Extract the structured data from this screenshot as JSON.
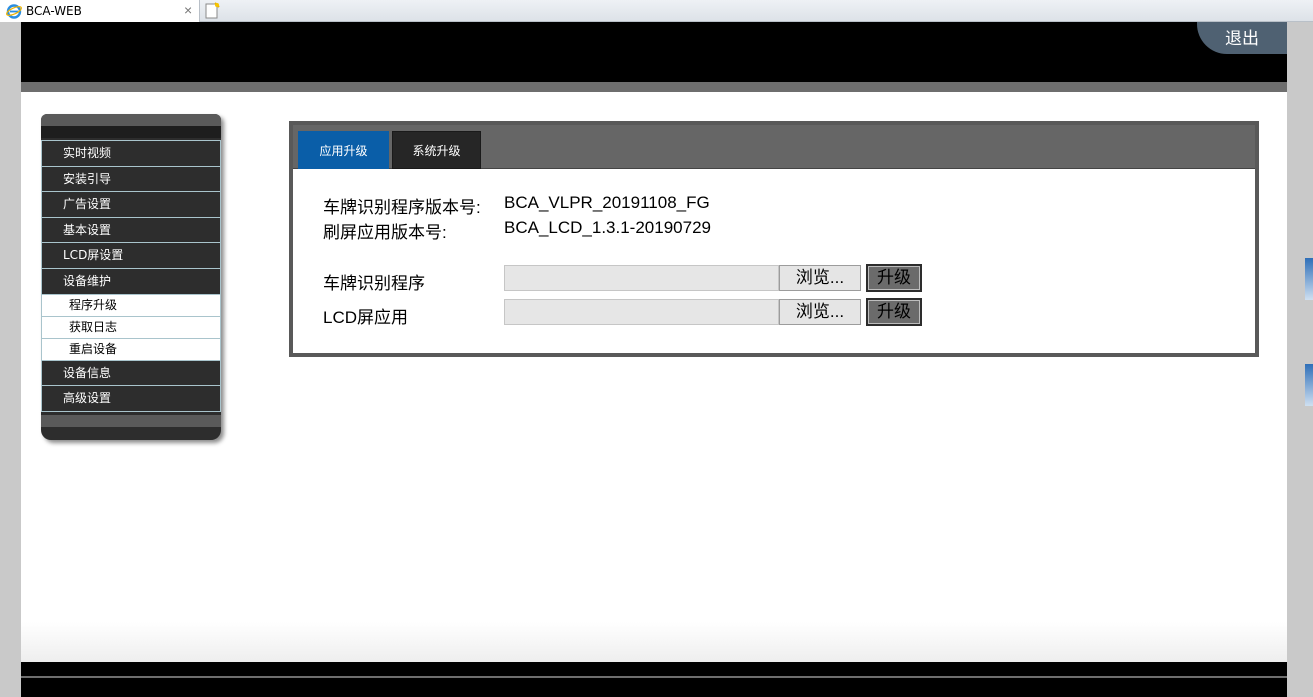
{
  "browser": {
    "tab_title": "BCA-WEB",
    "close_glyph": "×"
  },
  "header": {
    "logout_label": "退出"
  },
  "sidebar": {
    "items": [
      {
        "label": "实时视频"
      },
      {
        "label": "安装引导"
      },
      {
        "label": "广告设置"
      },
      {
        "label": "基本设置"
      },
      {
        "label": "LCD屏设置"
      },
      {
        "label": "设备维护",
        "expanded": true,
        "children": [
          {
            "label": "程序升级"
          },
          {
            "label": "获取日志"
          },
          {
            "label": "重启设备"
          }
        ]
      },
      {
        "label": "设备信息"
      },
      {
        "label": "高级设置"
      }
    ]
  },
  "panel": {
    "tabs": [
      {
        "label": "应用升级",
        "active": true
      },
      {
        "label": "系统升级",
        "active": false
      }
    ],
    "versions": [
      {
        "label": "车牌识别程序版本号:",
        "value": "BCA_VLPR_20191108_FG"
      },
      {
        "label": "刷屏应用版本号:",
        "value": "BCA_LCD_1.3.1-20190729"
      }
    ],
    "uploads": [
      {
        "label": "车牌识别程序",
        "browse_label": "浏览...",
        "upgrade_label": "升级"
      },
      {
        "label": "LCD屏应用",
        "browse_label": "浏览...",
        "upgrade_label": "升级"
      }
    ]
  },
  "colors": {
    "header_bg": "#000000",
    "active_tab": "#0a5ea8",
    "inactive_tab": "#262626",
    "sidebar_bg": "#2d2d2d",
    "logout_bg": "#4f6172"
  }
}
